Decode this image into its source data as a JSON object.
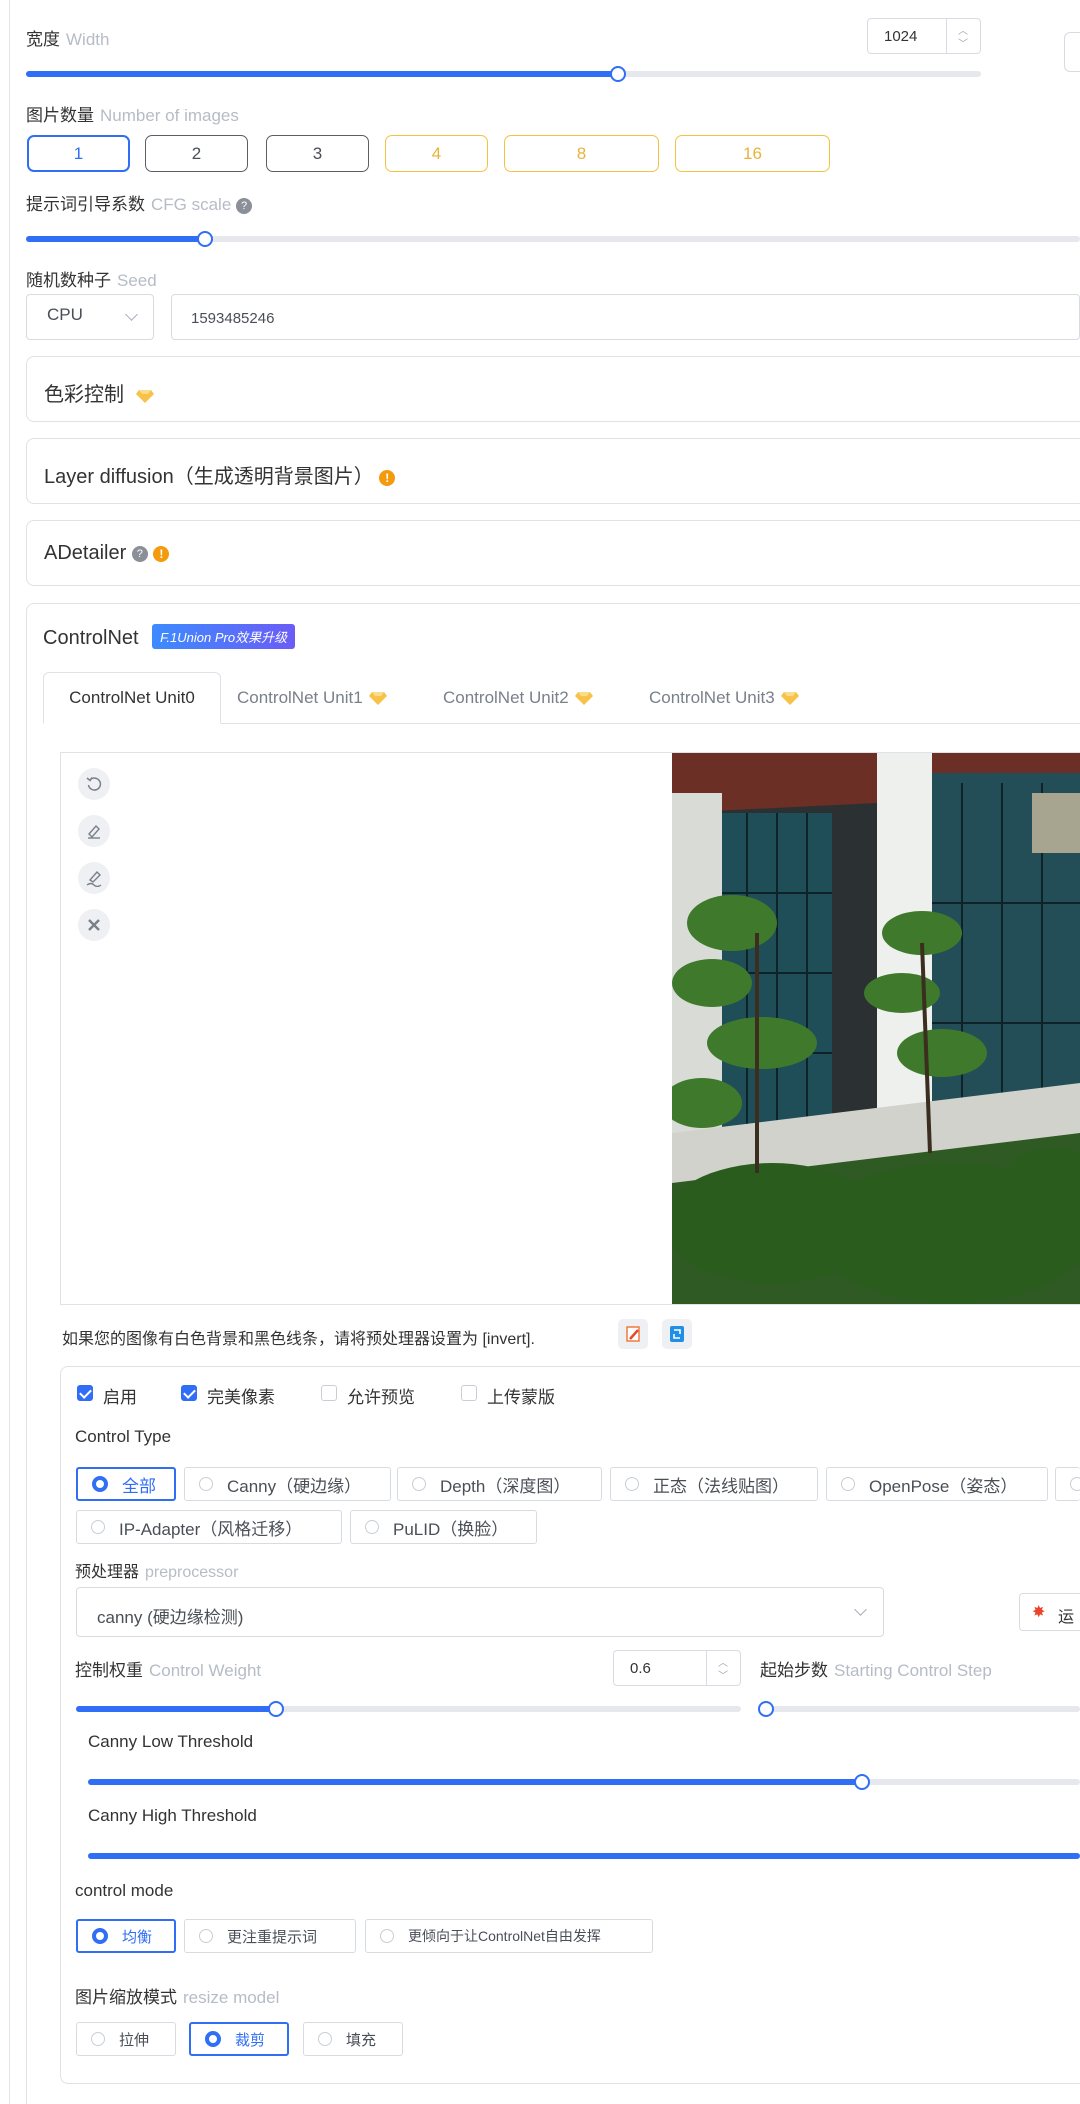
{
  "width": {
    "label": "宽度",
    "label_en": "Width",
    "value": "1024",
    "fraction": 0.62
  },
  "images": {
    "label": "图片数量",
    "label_en": "Number of images",
    "options": [
      "1",
      "2",
      "3",
      "4",
      "8",
      "16"
    ],
    "selected": "1"
  },
  "cfg": {
    "label": "提示词引导系数",
    "label_en": "CFG scale",
    "fraction": 0.17
  },
  "seed": {
    "label": "随机数种子",
    "label_en": "Seed",
    "device": "CPU",
    "value": "1593485246"
  },
  "panels": {
    "color": "色彩控制",
    "layer": "Layer diffusion（生成透明背景图片）",
    "adetailer": "ADetailer"
  },
  "controlnet": {
    "title": "ControlNet",
    "badge": "F.1Union Pro效果升级",
    "tabs": [
      "ControlNet Unit0",
      "ControlNet Unit1",
      "ControlNet Unit2",
      "ControlNet Unit3"
    ],
    "hint": "如果您的图像有白色背景和黑色线条，请将预处理器设置为 [invert].",
    "checks": [
      "启用",
      "完美像素",
      "允许预览",
      "上传蒙版"
    ],
    "control_type_label": "Control Type",
    "control_types": [
      "全部",
      "Canny（硬边缘）",
      "Depth（深度图）",
      "正态（法线贴图）",
      "OpenPose（姿态）",
      "IP-Adapter（风格迁移）",
      "PuLID（换脸）"
    ],
    "preprocessor_label": "预处理器",
    "preprocessor_label_en": "preprocessor",
    "preprocessor_value": "canny (硬边缘检测)",
    "run_label": "运",
    "weight_label": "控制权重",
    "weight_label_en": "Control Weight",
    "weight_value": "0.6",
    "weight_fraction": 0.3,
    "start_label": "起始步数",
    "start_label_en": "Starting Control Step",
    "low_label": "Canny Low Threshold",
    "low_fraction": 0.78,
    "high_label": "Canny High Threshold",
    "high_fraction": 1.0,
    "mode_label": "control mode",
    "modes": [
      "均衡",
      "更注重提示词",
      "更倾向于让ControlNet自由发挥"
    ],
    "resize_label": "图片缩放模式",
    "resize_label_en": "resize model",
    "resizes": [
      "拉伸",
      "裁剪",
      "填充"
    ]
  },
  "colors": {
    "accent": "#2f6ef5",
    "gold": "#f5c342",
    "warn": "#f39b0d"
  }
}
